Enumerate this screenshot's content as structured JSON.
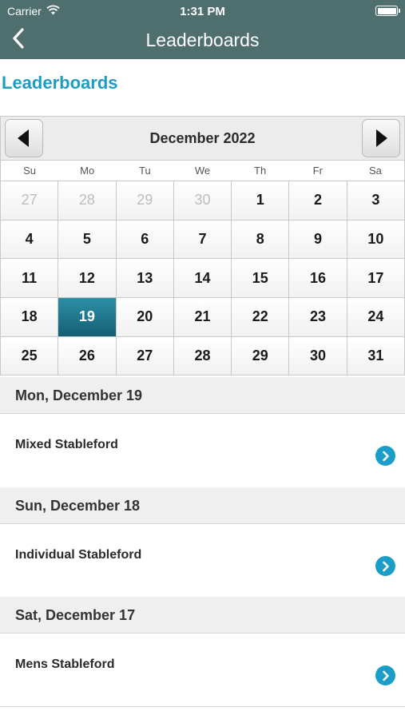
{
  "status_bar": {
    "carrier": "Carrier",
    "time": "1:31 PM"
  },
  "nav": {
    "title": "Leaderboards"
  },
  "heading": "Leaderboards",
  "calendar": {
    "month_label": "December 2022",
    "days_of_week": [
      "Su",
      "Mo",
      "Tu",
      "We",
      "Th",
      "Fr",
      "Sa"
    ],
    "weeks": [
      [
        "27",
        "28",
        "29",
        "30",
        "1",
        "2",
        "3"
      ],
      [
        "4",
        "5",
        "6",
        "7",
        "8",
        "9",
        "10"
      ],
      [
        "11",
        "12",
        "13",
        "14",
        "15",
        "16",
        "17"
      ],
      [
        "18",
        "19",
        "20",
        "21",
        "22",
        "23",
        "24"
      ],
      [
        "25",
        "26",
        "27",
        "28",
        "29",
        "30",
        "31"
      ]
    ],
    "selected_day": "19",
    "selected_color": "#1f7a92"
  },
  "events": [
    {
      "date_label": "Mon, December 19",
      "name": "Mixed Stableford"
    },
    {
      "date_label": "Sun, December 18",
      "name": "Individual Stableford"
    },
    {
      "date_label": "Sat, December 17",
      "name": "Mens Stableford"
    }
  ],
  "colors": {
    "header_bg": "#4f6e6e",
    "accent": "#1f9bc4",
    "chevron": "#1a9ec8"
  }
}
